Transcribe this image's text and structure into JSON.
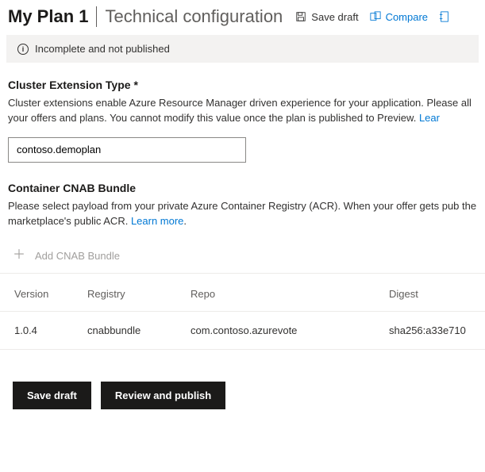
{
  "header": {
    "plan_title": "My Plan 1",
    "page_title": "Technical configuration"
  },
  "toolbar": {
    "save_draft_label": "Save draft",
    "compare_label": "Compare"
  },
  "status": {
    "text": "Incomplete and not published"
  },
  "cluster_ext": {
    "label": "Cluster Extension Type",
    "required_mark": "*",
    "help_pre": "Cluster extensions enable Azure Resource Manager driven experience for your application. Please all your offers and plans. You cannot modify this value once the plan is published to Preview. ",
    "learn_more": "Lear",
    "value": "contoso.demoplan"
  },
  "cnab": {
    "label": "Container CNAB Bundle",
    "help_pre": "Please select payload from your private Azure Container Registry (ACR). When your offer gets pub the marketplace's public ACR. ",
    "learn_more": "Learn more",
    "add_label": "Add CNAB Bundle",
    "columns": {
      "version": "Version",
      "registry": "Registry",
      "repo": "Repo",
      "digest": "Digest"
    },
    "rows": [
      {
        "version": "1.0.4",
        "registry": "cnabbundle",
        "repo": "com.contoso.azurevote",
        "digest": "sha256:a33e710"
      }
    ]
  },
  "footer": {
    "save_draft": "Save draft",
    "review_publish": "Review and publish"
  }
}
